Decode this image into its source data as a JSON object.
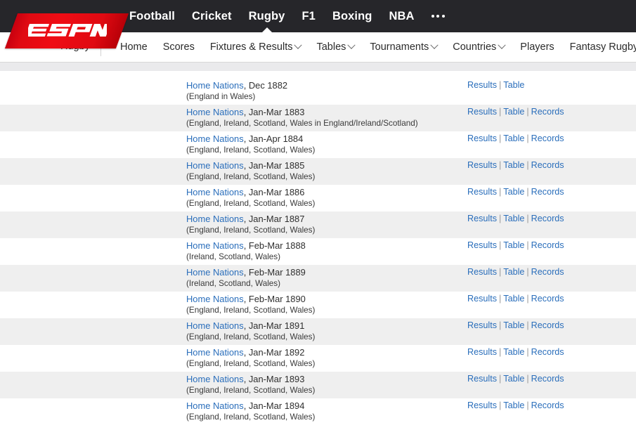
{
  "topbar": {
    "logo_text": "ESPN",
    "links": [
      {
        "label": "Football",
        "active": false
      },
      {
        "label": "Cricket",
        "active": false
      },
      {
        "label": "Rugby",
        "active": true
      },
      {
        "label": "F1",
        "active": false
      },
      {
        "label": "Boxing",
        "active": false
      },
      {
        "label": "NBA",
        "active": false
      }
    ],
    "more_icon": "ellipsis-icon"
  },
  "subnav": {
    "sport_label": "Rugby",
    "items": [
      {
        "label": "Home",
        "caret": false,
        "external": false
      },
      {
        "label": "Scores",
        "caret": false,
        "external": false
      },
      {
        "label": "Fixtures & Results",
        "caret": true,
        "external": false
      },
      {
        "label": "Tables",
        "caret": true,
        "external": false
      },
      {
        "label": "Tournaments",
        "caret": true,
        "external": false
      },
      {
        "label": "Countries",
        "caret": true,
        "external": false
      },
      {
        "label": "Players",
        "caret": false,
        "external": false
      },
      {
        "label": "Fantasy Rugby",
        "caret": false,
        "external": true
      }
    ]
  },
  "colors": {
    "brand_red": "#e00a12",
    "topbar_bg": "#26262a",
    "link_blue": "#2a6ebb",
    "row_alt_bg": "#efefef",
    "band_bg": "#eaeaec"
  },
  "list": {
    "link_labels": {
      "results": "Results",
      "table": "Table",
      "records": "Records"
    },
    "rows": [
      {
        "name": "Home Nations",
        "dates": ", Dec 1882",
        "teams": "(England in Wales)",
        "links": [
          "Results",
          "Table"
        ]
      },
      {
        "name": "Home Nations",
        "dates": ", Jan-Mar 1883",
        "teams": "(England, Ireland, Scotland, Wales in England/Ireland/Scotland)",
        "links": [
          "Results",
          "Table",
          "Records"
        ]
      },
      {
        "name": "Home Nations",
        "dates": ", Jan-Apr 1884",
        "teams": "(England, Ireland, Scotland, Wales)",
        "links": [
          "Results",
          "Table",
          "Records"
        ]
      },
      {
        "name": "Home Nations",
        "dates": ", Jan-Mar 1885",
        "teams": "(England, Ireland, Scotland, Wales)",
        "links": [
          "Results",
          "Table",
          "Records"
        ]
      },
      {
        "name": "Home Nations",
        "dates": ", Jan-Mar 1886",
        "teams": "(England, Ireland, Scotland, Wales)",
        "links": [
          "Results",
          "Table",
          "Records"
        ]
      },
      {
        "name": "Home Nations",
        "dates": ", Jan-Mar 1887",
        "teams": "(England, Ireland, Scotland, Wales)",
        "links": [
          "Results",
          "Table",
          "Records"
        ]
      },
      {
        "name": "Home Nations",
        "dates": ", Feb-Mar 1888",
        "teams": "(Ireland, Scotland, Wales)",
        "links": [
          "Results",
          "Table",
          "Records"
        ]
      },
      {
        "name": "Home Nations",
        "dates": ", Feb-Mar 1889",
        "teams": "(Ireland, Scotland, Wales)",
        "links": [
          "Results",
          "Table",
          "Records"
        ]
      },
      {
        "name": "Home Nations",
        "dates": ", Feb-Mar 1890",
        "teams": "(England, Ireland, Scotland, Wales)",
        "links": [
          "Results",
          "Table",
          "Records"
        ]
      },
      {
        "name": "Home Nations",
        "dates": ", Jan-Mar 1891",
        "teams": "(England, Ireland, Scotland, Wales)",
        "links": [
          "Results",
          "Table",
          "Records"
        ]
      },
      {
        "name": "Home Nations",
        "dates": ", Jan-Mar 1892",
        "teams": "(England, Ireland, Scotland, Wales)",
        "links": [
          "Results",
          "Table",
          "Records"
        ]
      },
      {
        "name": "Home Nations",
        "dates": ", Jan-Mar 1893",
        "teams": "(England, Ireland, Scotland, Wales)",
        "links": [
          "Results",
          "Table",
          "Records"
        ]
      },
      {
        "name": "Home Nations",
        "dates": ", Jan-Mar 1894",
        "teams": "(England, Ireland, Scotland, Wales)",
        "links": [
          "Results",
          "Table",
          "Records"
        ]
      }
    ]
  }
}
